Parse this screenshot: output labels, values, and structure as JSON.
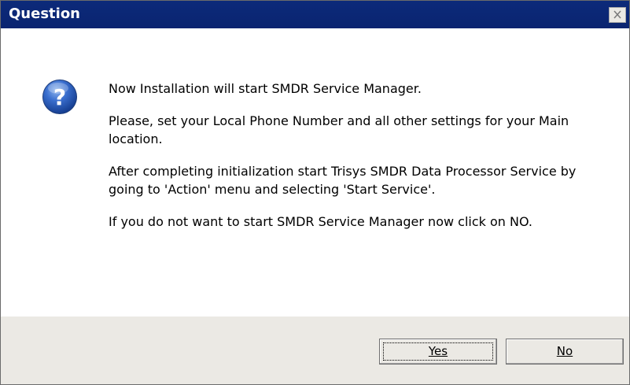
{
  "dialog": {
    "title": "Question",
    "close_icon": "close-icon",
    "icon": "question-icon",
    "message": {
      "line1": "Now Installation will start SMDR Service Manager.",
      "line2": "Please, set your Local Phone Number and all other settings for your Main location.",
      "line3": "After completing initialization start Trisys SMDR Data Processor Service by going to 'Action' menu and selecting 'Start Service'.",
      "line4": "If you do not want to start SMDR Service Manager now click on NO."
    },
    "buttons": {
      "yes_label": "Yes",
      "no_label": "No"
    }
  },
  "colors": {
    "titlebar": "#0a2470",
    "footer": "#ebe9e4",
    "icon_blue": "#2b5fb8"
  }
}
